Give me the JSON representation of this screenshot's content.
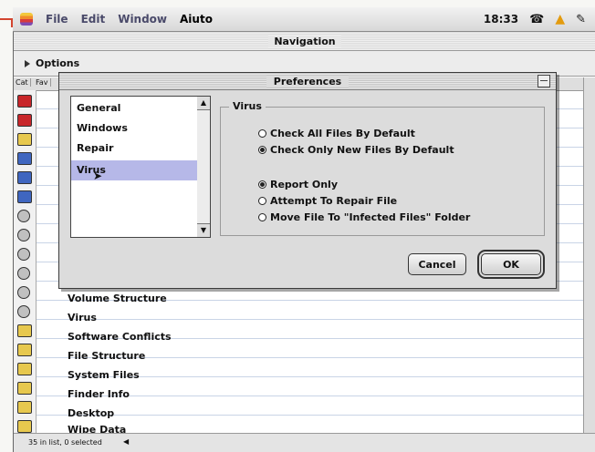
{
  "menubar": {
    "items": [
      "File",
      "Edit",
      "Window",
      "Aiuto"
    ],
    "time": "18:33"
  },
  "navigation": {
    "title": "Navigation",
    "options_label": "Options",
    "column_headers": [
      "Cat",
      "Fav"
    ],
    "list_items": [
      "Volume Structure",
      "Virus",
      "Software Conflicts",
      "File Structure",
      "System Files",
      "Finder Info",
      "Desktop",
      "Wipe Data"
    ],
    "status": "35 in list, 0 selected"
  },
  "preferences": {
    "title": "Preferences",
    "categories": [
      "General",
      "Windows",
      "Repair",
      "Virus"
    ],
    "selected_category": "Virus",
    "group_label": "Virus",
    "scan_options": [
      {
        "label": "Check All Files By Default",
        "selected": false
      },
      {
        "label": "Check Only New Files By Default",
        "selected": true
      }
    ],
    "action_options": [
      {
        "label": "Report Only",
        "selected": true
      },
      {
        "label": "Attempt To Repair File",
        "selected": false
      },
      {
        "label": "Move File To \"Infected Files\" Folder",
        "selected": false
      }
    ],
    "cancel_label": "Cancel",
    "ok_label": "OK"
  }
}
